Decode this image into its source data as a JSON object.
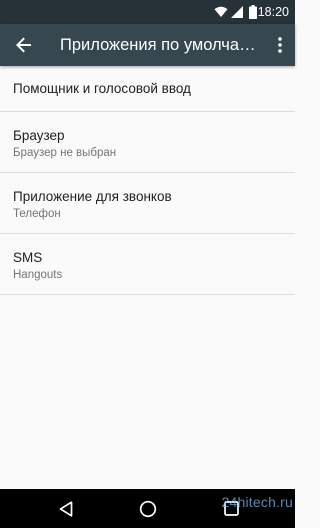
{
  "status_bar": {
    "time": "18:20",
    "icons": [
      "wifi-icon",
      "signal-icon",
      "battery-icon"
    ]
  },
  "toolbar": {
    "title": "Приложения по умолчанию",
    "icons": [
      "back-arrow-icon",
      "more-vert-icon"
    ]
  },
  "items": [
    {
      "title": "Помощник и голосовой ввод"
    },
    {
      "title": "Браузер",
      "summary": "Браузер не выбран"
    },
    {
      "title": "Приложение для звонков",
      "summary": "Телефон"
    },
    {
      "title": "SMS",
      "summary": "Hangouts"
    }
  ],
  "nav_bar": {
    "icons": [
      "back-triangle-icon",
      "home-circle-icon",
      "recents-square-icon"
    ]
  },
  "watermark": "24hitech.ru",
  "colors": {
    "status_bar": "#263238",
    "toolbar": "#37474f",
    "background": "#fafafa",
    "divider": "#dcdcdc",
    "primary_text": "#212121",
    "secondary_text": "#757575"
  }
}
